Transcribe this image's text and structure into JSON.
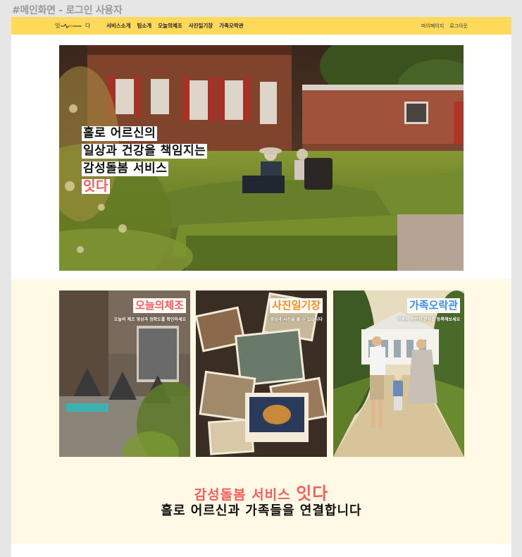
{
  "frame": {
    "title": "#메인화면 - 로그인 사용자"
  },
  "colors": {
    "nav_bg": "#ffd95a",
    "accent_red": "#ff5a5a",
    "accent_orange": "#ff8c1a",
    "accent_blue": "#3a8ee6",
    "section_bg": "#fff9e6"
  },
  "nav": {
    "logo": {
      "left": "잇",
      "right": "다"
    },
    "menu": [
      "서비스소개",
      "팀소개",
      "오늘의체조",
      "사진일기장",
      "가족오락관"
    ],
    "right": [
      "마이페이지",
      "로그아웃"
    ]
  },
  "hero": {
    "lines": [
      "홀로 어르신의",
      "일상과 건강을 책임지는",
      "감성돌봄 서비스"
    ],
    "accent": "잇다"
  },
  "cards": [
    {
      "title": "오늘의체조",
      "subtitle": "오늘의 체조 영상과 정확도를 확인하세요"
    },
    {
      "title": "사진일기장",
      "subtitle": "영상과 사진을 볼 수 있습니다"
    },
    {
      "title": "가족오락관",
      "subtitle": "가족과 관련된 문제를 등록해보세요"
    }
  ],
  "tagline": {
    "line1_prefix": "감성돌봄 서비스",
    "line1_brand": "잇다",
    "line2": "홀로 어르신과 가족들을 연결합니다"
  }
}
